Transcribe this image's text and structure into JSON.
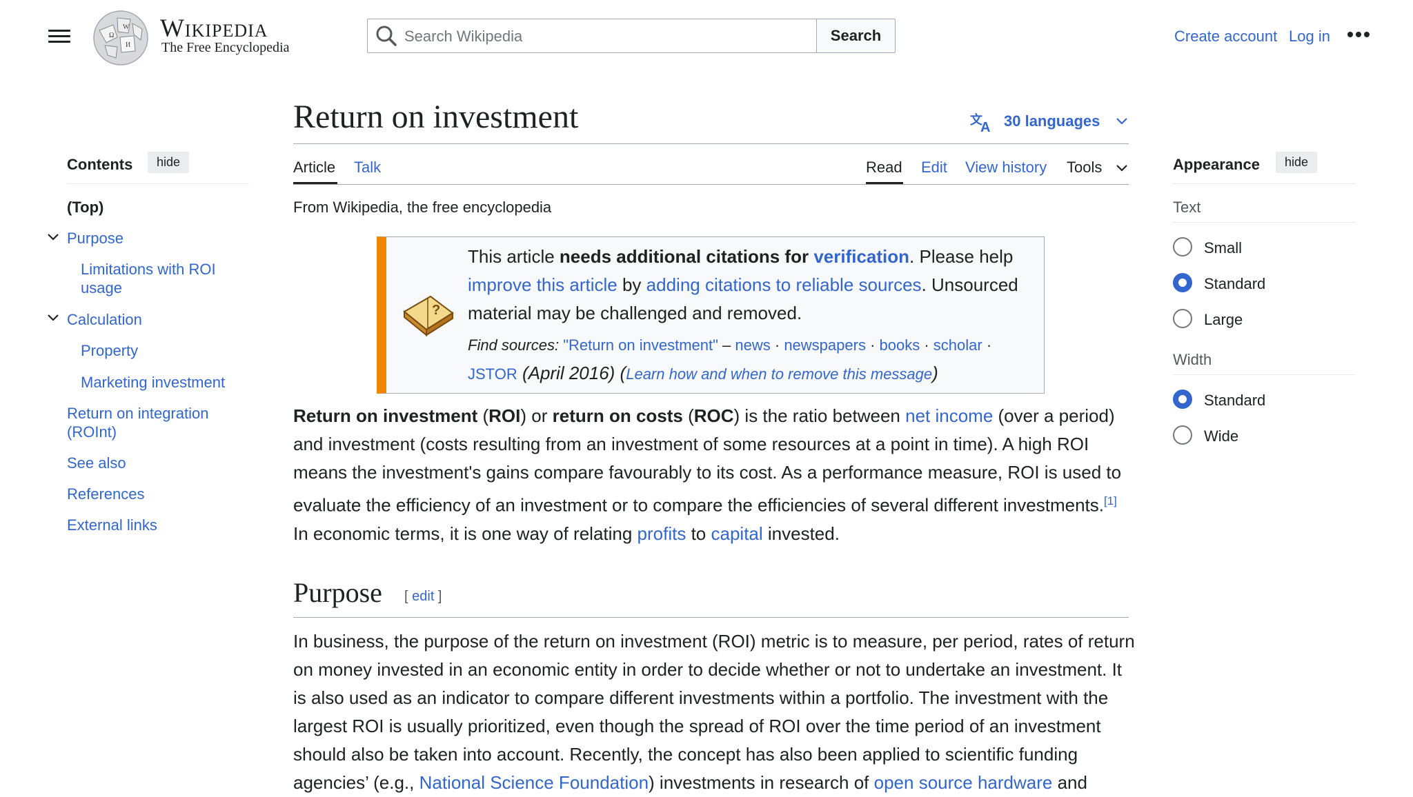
{
  "header": {
    "wordmark": "Wikipedia",
    "tagline": "The Free Encyclopedia",
    "search_placeholder": "Search Wikipedia",
    "search_button": "Search",
    "create_account": "Create account",
    "login": "Log in"
  },
  "toc": {
    "title": "Contents",
    "hide": "hide",
    "top": "(Top)",
    "purpose": "Purpose",
    "limitations_1": "Limitations with ROI",
    "limitations_2": "usage",
    "calculation": "Calculation",
    "property": "Property",
    "marketing": "Marketing investment",
    "roint_1": "Return on integration",
    "roint_2": "(ROInt)",
    "see_also": "See also",
    "references": "References",
    "external": "External links"
  },
  "article": {
    "title": "Return on investment",
    "languages": "30 languages",
    "tabs": {
      "article": "Article",
      "talk": "Talk",
      "read": "Read",
      "edit": "Edit",
      "history": "View history",
      "tools": "Tools"
    },
    "from": "From Wikipedia, the free encyclopedia",
    "ambox": {
      "t1": "This article ",
      "t2": "needs additional citations for ",
      "t3": "verification",
      "t4": ". Please help ",
      "t5": "improve this article",
      "t6": " by ",
      "t7": "adding citations to reliable sources",
      "t8": ". Unsourced material may be challenged and removed.",
      "find": "Find sources:",
      "q": "\"Return on investment\"",
      "dash": " – ",
      "news": "news",
      "newspapers": "newspapers",
      "books": "books",
      "scholar": "scholar",
      "jstor": "JSTOR",
      "date": " (April 2016) (",
      "learn": "Learn how and when to remove this message",
      "close": ")"
    },
    "lead": {
      "b1": "Return on investment",
      "t1": " (",
      "b2": "ROI",
      "t2": ") or ",
      "b3": "return on costs",
      "t3": " (",
      "b4": "ROC",
      "t4": ") is the ratio between ",
      "l1": "net income",
      "t5": " (over a period) and investment (costs resulting from an investment of some resources at a point in time). A high ROI means the investment's gains compare favourably to its cost. As a performance measure, ROI is used to evaluate the efficiency of an investment or to compare the efficiencies of several different investments.",
      "ref": "[1]",
      "t6": " In economic terms, it is one way of relating ",
      "l2": "profits",
      "t7": " to ",
      "l3": "capital",
      "t8": " invested."
    },
    "purpose_heading": "Purpose",
    "edit_label": "edit",
    "purpose": {
      "t1": "In business, the purpose of the return on investment (ROI) metric is to measure, per period, rates of return on money invested in an economic entity in order to decide whether or not to undertake an investment. It is also used as an indicator to compare different investments within a portfolio. The investment with the largest ROI is usually prioritized, even though the spread of ROI over the time period of an investment should also be taken into account. Recently, the concept has also been applied to scientific funding agencies’ (e.g., ",
      "l1": "National Science Foundation",
      "t2": ") investments in research of ",
      "l2": "open source hardware",
      "t3": " and"
    }
  },
  "appearance": {
    "title": "Appearance",
    "hide": "hide",
    "text_label": "Text",
    "small": "Small",
    "standard": "Standard",
    "large": "Large",
    "width_label": "Width",
    "w_standard": "Standard",
    "w_wide": "Wide",
    "selected_text": "Standard",
    "selected_width": "Standard"
  },
  "colors": {
    "link": "#3366cc",
    "ambox_stripe": "#f28500",
    "text": "#202122"
  }
}
